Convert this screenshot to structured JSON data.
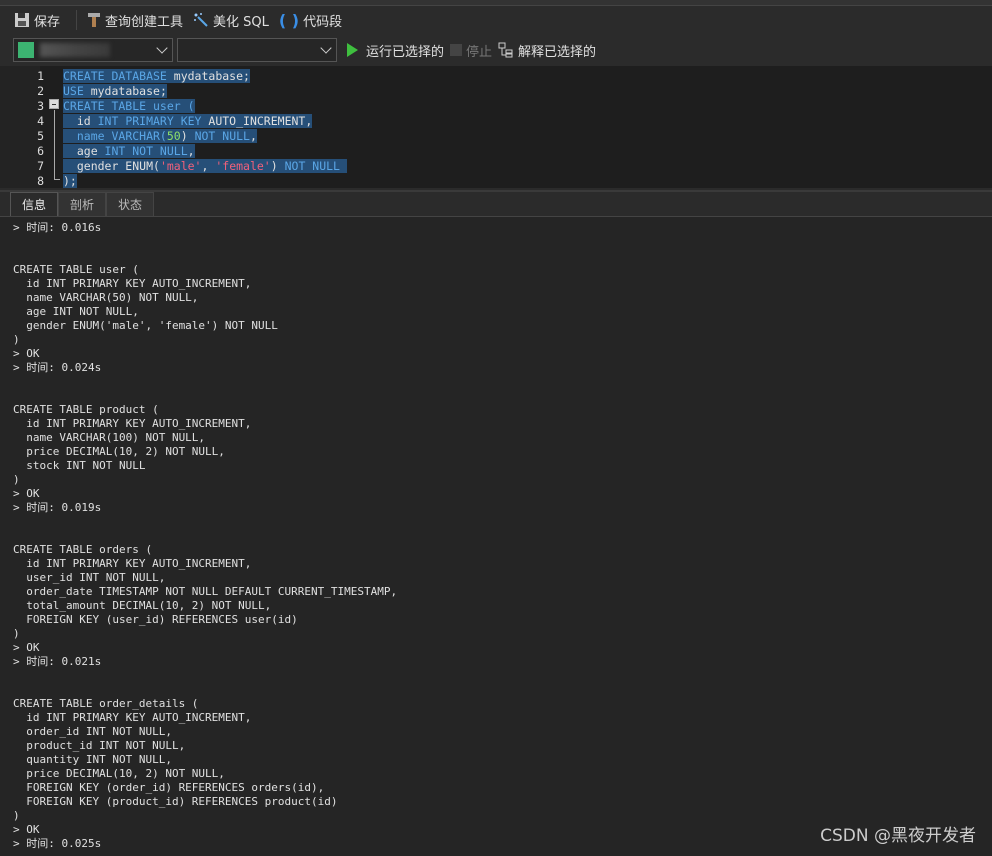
{
  "toolbar": {
    "save": "保存",
    "query_builder": "查询创建工具",
    "beautify": "美化 SQL",
    "snippet": "代码段"
  },
  "toolbar2": {
    "connection_value": "",
    "database_value": "",
    "run_selected": "运行已选择的",
    "stop": "停止",
    "explain_selected": "解释已选择的"
  },
  "editor": {
    "lines": [
      {
        "n": "1",
        "tokens": [
          [
            "CREATE DATABASE ",
            "kw"
          ],
          [
            "mydatabase;",
            "id"
          ]
        ]
      },
      {
        "n": "2",
        "tokens": [
          [
            "USE ",
            "kw"
          ],
          [
            "mydatabase;",
            "id"
          ]
        ]
      },
      {
        "n": "3",
        "tokens": [
          [
            "CREATE TABLE user (",
            "kw"
          ]
        ]
      },
      {
        "n": "4",
        "tokens": [
          [
            "  id ",
            "id"
          ],
          [
            "INT PRIMARY KEY ",
            "kw"
          ],
          [
            "AUTO_INCREMENT,",
            "id"
          ]
        ]
      },
      {
        "n": "5",
        "tokens": [
          [
            "  name ",
            "kw"
          ],
          [
            "VARCHAR(",
            "kw"
          ],
          [
            "50",
            "num"
          ],
          [
            ") ",
            "id"
          ],
          [
            "NOT NULL",
            "kw"
          ],
          [
            ",",
            "id"
          ]
        ]
      },
      {
        "n": "6",
        "tokens": [
          [
            "  age ",
            "id"
          ],
          [
            "INT NOT NULL",
            "kw"
          ],
          [
            ",",
            "id"
          ]
        ]
      },
      {
        "n": "7",
        "tokens": [
          [
            "  gender ENUM(",
            "id"
          ],
          [
            "'male'",
            "str"
          ],
          [
            ", ",
            "id"
          ],
          [
            "'female'",
            "str"
          ],
          [
            ") ",
            "id"
          ],
          [
            "NOT NULL ",
            "kw"
          ]
        ]
      },
      {
        "n": "8",
        "tokens": [
          [
            ");",
            "id"
          ]
        ]
      }
    ]
  },
  "tabs": [
    {
      "label": "信息",
      "active": true
    },
    {
      "label": "剖析"
    },
    {
      "label": "状态"
    }
  ],
  "output": [
    "> 时间: 0.016s",
    "",
    "",
    "CREATE TABLE user (",
    "  id INT PRIMARY KEY AUTO_INCREMENT,",
    "  name VARCHAR(50) NOT NULL,",
    "  age INT NOT NULL,",
    "  gender ENUM('male', 'female') NOT NULL",
    ")",
    "> OK",
    "> 时间: 0.024s",
    "",
    "",
    "CREATE TABLE product (",
    "  id INT PRIMARY KEY AUTO_INCREMENT,",
    "  name VARCHAR(100) NOT NULL,",
    "  price DECIMAL(10, 2) NOT NULL,",
    "  stock INT NOT NULL",
    ")",
    "> OK",
    "> 时间: 0.019s",
    "",
    "",
    "CREATE TABLE orders (",
    "  id INT PRIMARY KEY AUTO_INCREMENT,",
    "  user_id INT NOT NULL,",
    "  order_date TIMESTAMP NOT NULL DEFAULT CURRENT_TIMESTAMP,",
    "  total_amount DECIMAL(10, 2) NOT NULL,",
    "  FOREIGN KEY (user_id) REFERENCES user(id)",
    ")",
    "> OK",
    "> 时间: 0.021s",
    "",
    "",
    "CREATE TABLE order_details (",
    "  id INT PRIMARY KEY AUTO_INCREMENT,",
    "  order_id INT NOT NULL,",
    "  product_id INT NOT NULL,",
    "  quantity INT NOT NULL,",
    "  price DECIMAL(10, 2) NOT NULL,",
    "  FOREIGN KEY (order_id) REFERENCES orders(id),",
    "  FOREIGN KEY (product_id) REFERENCES product(id)",
    ")",
    "> OK",
    "> 时间: 0.025s"
  ],
  "watermark": "CSDN @黑夜开发者",
  "colors": {
    "selection": "#264f78",
    "keyword": "#5aa6e6",
    "string": "#f0607a",
    "number": "#8ee06a",
    "run": "#3fbf3f"
  }
}
